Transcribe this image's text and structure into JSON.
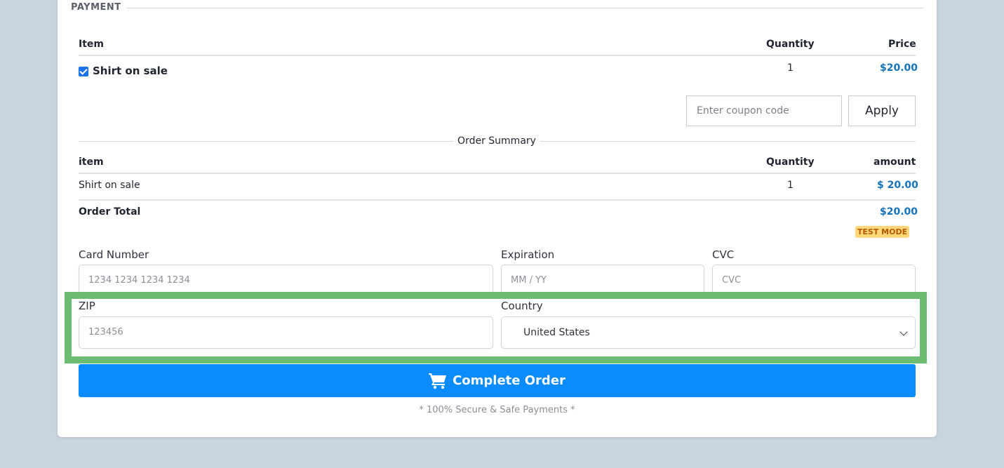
{
  "payment": {
    "legend": "PAYMENT",
    "headers": {
      "item": "Item",
      "quantity": "Quantity",
      "price": "Price"
    },
    "items": [
      {
        "name": "Shirt on sale",
        "quantity": "1",
        "price": "$20.00",
        "checked": true
      }
    ],
    "coupon": {
      "placeholder": "Enter coupon code",
      "apply_label": "Apply"
    }
  },
  "summary": {
    "title": "Order Summary",
    "headers": {
      "item": "item",
      "quantity": "Quantity",
      "amount": "amount"
    },
    "rows": [
      {
        "name": "Shirt on sale",
        "quantity": "1",
        "amount": "$ 20.00"
      }
    ],
    "total_label": "Order Total",
    "total_value": "$20.00",
    "test_mode_badge": "TEST MODE"
  },
  "card_form": {
    "card_number": {
      "label": "Card Number",
      "placeholder": "1234 1234 1234 1234"
    },
    "expiration": {
      "label": "Expiration",
      "placeholder": "MM / YY"
    },
    "cvc": {
      "label": "CVC",
      "placeholder": "CVC"
    },
    "zip": {
      "label": "ZIP",
      "placeholder": "123456"
    },
    "country": {
      "label": "Country",
      "selected": "United States"
    }
  },
  "actions": {
    "complete_order_label": "Complete Order",
    "cart_icon": "cart-icon",
    "secure_note": "* 100% Secure & Safe Payments *"
  },
  "colors": {
    "accent_blue": "#0a8cff",
    "price_blue": "#1573b9",
    "highlight_green": "#6cbd71",
    "badge_yellow": "#ffd77a"
  }
}
